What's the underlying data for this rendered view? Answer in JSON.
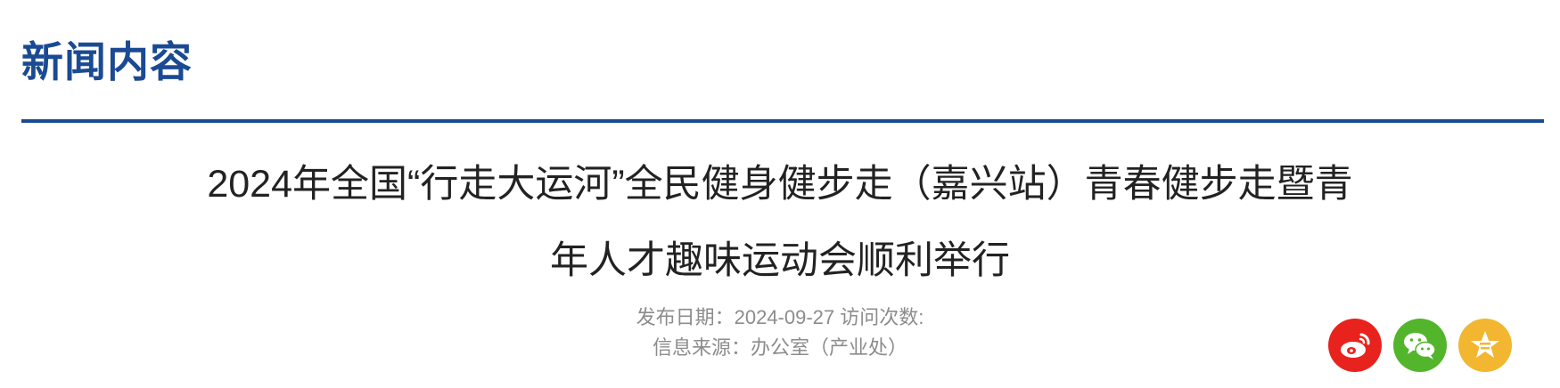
{
  "section": {
    "title": "新闻内容"
  },
  "article": {
    "title_line1": "2024年全国“行走大运河”全民健身健步走（嘉兴站）青春健步走暨青",
    "title_line2": "年人才趣味运动会顺利举行",
    "meta_line1": "发布日期：2024-09-27 访问次数:",
    "meta_line2": "信息来源：办公室（产业处）"
  },
  "share": [
    {
      "icon": "weibo-icon",
      "color": "#e8231d"
    },
    {
      "icon": "wechat-icon",
      "color": "#52b52c"
    },
    {
      "icon": "star-icon",
      "color": "#f2b630"
    }
  ],
  "colors": {
    "accent": "#1a4a93",
    "text": "#222222",
    "meta": "#8c8c8c"
  }
}
